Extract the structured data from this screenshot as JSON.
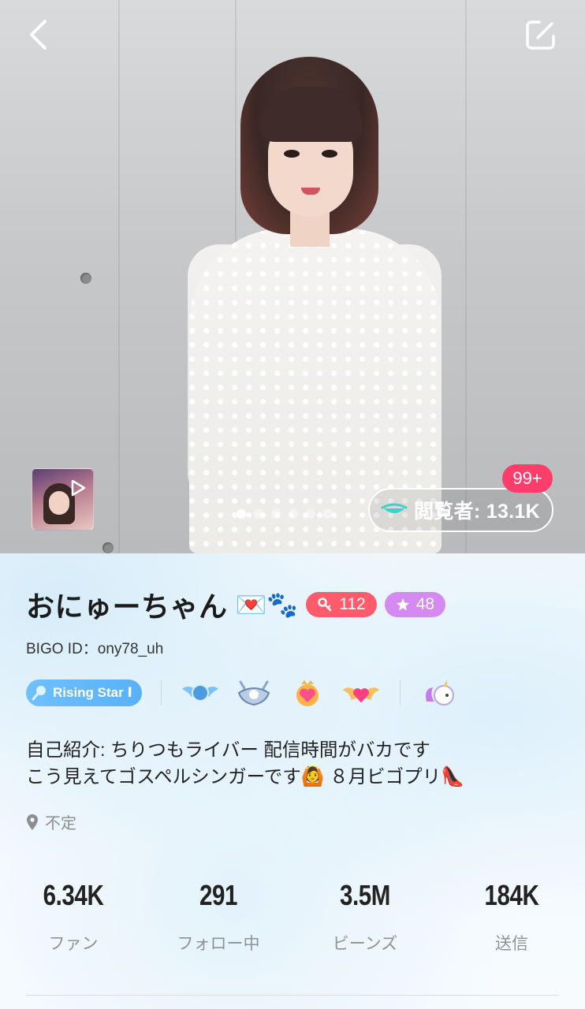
{
  "hero": {
    "viewers_label": "閲覧者: 13.1K",
    "viewers_badge": "99+",
    "photo_count": 1,
    "active_photo": 1
  },
  "profile": {
    "name": "おにゅーちゃん",
    "name_emojis": "💌🐾",
    "level_badge": "112",
    "star_badge": "48",
    "bigo_id": "BIGO ID：ony78_uh",
    "rising_star_label": "Rising Star Ⅰ",
    "bio_line1": "自己紹介: ちりつもライバー 配信時間がバカです",
    "bio_line2_text": "こう見えてゴスペルシンガーです",
    "bio_line2_emoji1": "🙆",
    "bio_line2_text2": "８月ビゴプリ",
    "bio_line2_emoji2": "👠",
    "location": "不定"
  },
  "stats": [
    {
      "value": "6.34K",
      "label": "ファン"
    },
    {
      "value": "291",
      "label": "フォロー中"
    },
    {
      "value": "3.5M",
      "label": "ビーンズ"
    },
    {
      "value": "184K",
      "label": "送信"
    }
  ],
  "colors": {
    "accent_pink": "#ff3d6b",
    "level_red": "#ff5b6b",
    "star_purple": "#d48af0",
    "rising_star_blue": "#58b1f7"
  },
  "icons": {
    "back": "chevron-left-icon",
    "edit": "edit-icon",
    "play": "play-icon",
    "viewer": "eye-icon",
    "location": "location-pin-icon"
  }
}
